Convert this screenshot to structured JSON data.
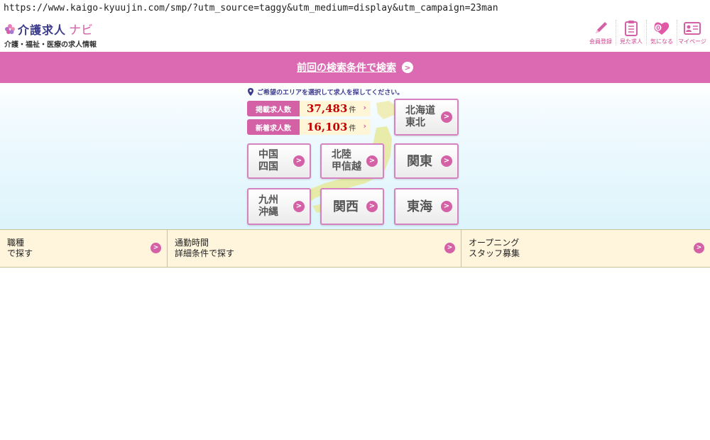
{
  "browser": {
    "url": "https://www.kaigo-kyuujin.com/smp/?utm_source=taggy&utm_medium=display&utm_campaign=23man"
  },
  "header": {
    "logo_main": "介護求人",
    "logo_navi": "ナビ",
    "logo_sub": "介護・福祉・医療の求人情報",
    "nav": [
      {
        "label": "会員登録",
        "icon": "pencil-icon"
      },
      {
        "label": "見た求人",
        "icon": "clipboard-icon"
      },
      {
        "label": "気になる",
        "icon": "heart-icon",
        "badge": "0"
      },
      {
        "label": "マイページ",
        "icon": "id-card-icon"
      }
    ]
  },
  "search_bar": {
    "label": "前回の検索条件で検索",
    "icon": "arrow-right-icon"
  },
  "map_section": {
    "instruction": "ご希望のエリアを選択して求人を探してください。",
    "counts": [
      {
        "label": "掲載求人数",
        "value": "37,483",
        "unit": "件"
      },
      {
        "label": "新着求人数",
        "value": "16,103",
        "unit": "件"
      }
    ],
    "regions": {
      "hokkaido_tohoku": [
        "北海道",
        "東北"
      ],
      "chugoku_shikoku": [
        "中国",
        "四国"
      ],
      "hokuriku_koshinetsu": [
        "北陸",
        "甲信越"
      ],
      "kanto": "関東",
      "kyushu_okinawa": [
        "九州",
        "沖縄"
      ],
      "kansai": "関西",
      "tokai": "東海"
    }
  },
  "filters": [
    {
      "line1": "職種",
      "line2": "で探す"
    },
    {
      "line1": "通勤時間",
      "line2": "詳細条件で探す"
    },
    {
      "line1": "オープニング",
      "line2": "スタッフ募集"
    }
  ],
  "colors": {
    "accent": "#dc6ab2",
    "count_value": "#c40000",
    "logo_text": "#3b3b8c",
    "filter_bg": "#fff4dc"
  }
}
